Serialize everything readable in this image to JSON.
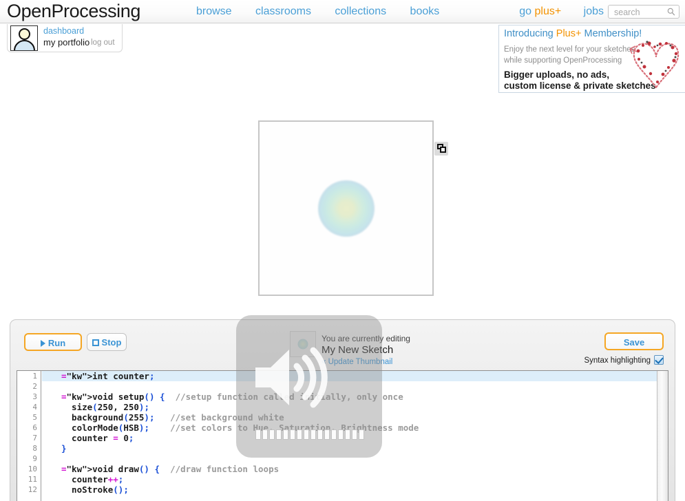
{
  "site": {
    "logo": "OpenProcessing",
    "nav": [
      {
        "label": "browse"
      },
      {
        "label": "classrooms"
      },
      {
        "label": "collections"
      },
      {
        "label": "books"
      }
    ],
    "nav_right": [
      {
        "label_plain": "go ",
        "label_accent": "plus+"
      },
      {
        "label": "jobs"
      }
    ],
    "search": {
      "placeholder": "search",
      "value": "",
      "icon": "search-icon"
    }
  },
  "user_card": {
    "avatar_icon": "user-avatar-icon",
    "dashboard": "dashboard",
    "portfolio": "my portfolio",
    "logout": "log out"
  },
  "plus_banner": {
    "title_pre": "Introducing ",
    "title_accent": "Plus+",
    "title_post": " Membership!",
    "sub_line1": "Enjoy the next level for your sketches",
    "sub_line2": "while supporting OpenProcessing",
    "bold_line1": "Bigger uploads, no ads,",
    "bold_line2": "custom license & private sketches",
    "decoration_icon": "heart-particles-icon"
  },
  "sketch": {
    "canvas_name": "sketch-canvas",
    "thumbnail_icon": "duplicate-windows-icon"
  },
  "editor": {
    "run_label": "Run",
    "stop_label": "Stop",
    "save_label": "Save",
    "syntax_label": "Syntax highlighting",
    "syntax_checked": true,
    "editing_notice": "You are currently editing",
    "sketch_title": "My New Sketch",
    "update_thumbnail": "« Update Thumbnail",
    "line_numbers": [
      "1",
      "2",
      "3",
      "4",
      "5",
      "6",
      "7",
      "8",
      "9",
      "10",
      "11",
      "12"
    ],
    "code": [
      "int counter;",
      "",
      "void setup() {  //setup function called initially, only once",
      "  size(250, 250);",
      "  background(255);   //set background white",
      "  colorMode(HSB);    //set colors to Hue, Saturation, Brightness mode",
      "  counter = 0;",
      "}",
      "",
      "void draw() {  //draw function loops",
      "  counter++;",
      "  noStroke();"
    ]
  },
  "osd": {
    "icon": "speaker-volume-icon",
    "segments_total": 16,
    "segments_filled": 0
  },
  "colors": {
    "link_blue": "#4a9fd6",
    "accent_orange": "#f39200",
    "button_border": "#f5a623",
    "keyword_green": "#2e8b1f",
    "operator_magenta": "#d216d2",
    "paren_blue": "#1a4fd6",
    "comment_gray": "#9b9b9b"
  }
}
